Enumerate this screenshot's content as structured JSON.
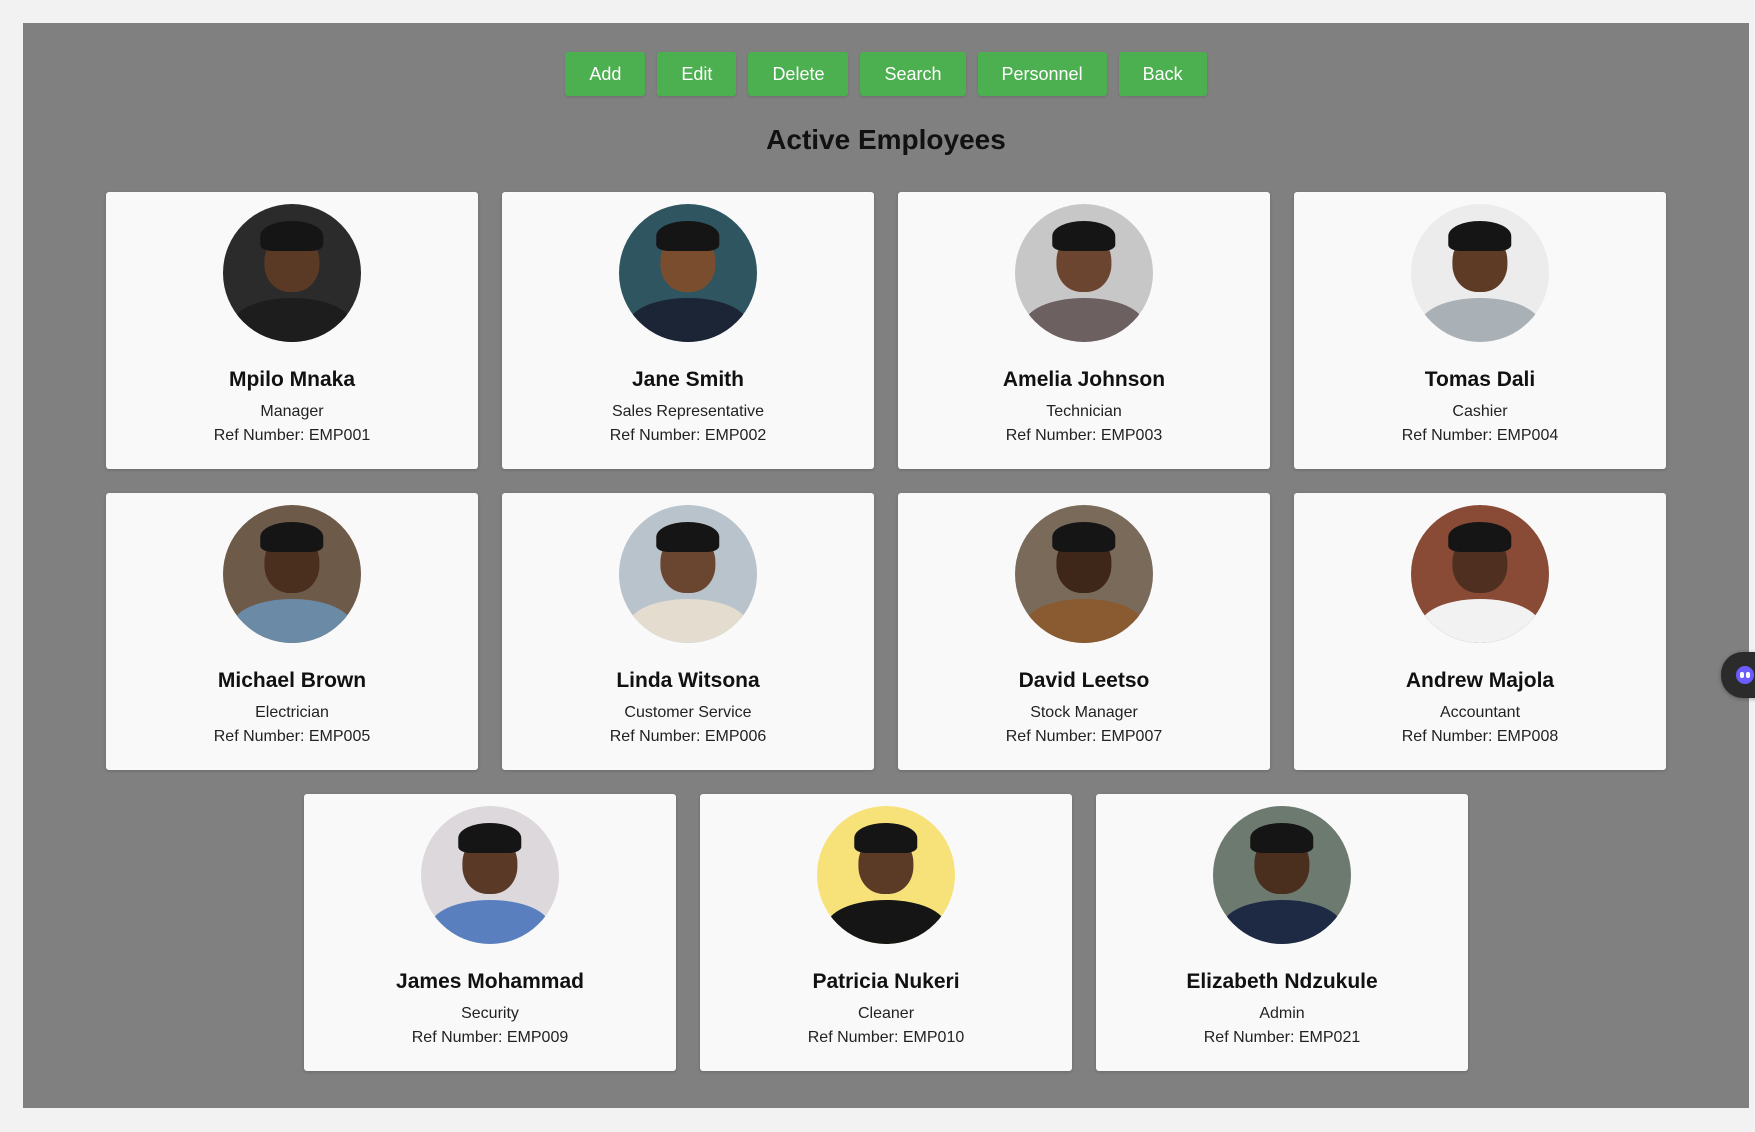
{
  "toolbar": {
    "buttons": [
      {
        "label": "Add"
      },
      {
        "label": "Edit"
      },
      {
        "label": "Delete"
      },
      {
        "label": "Search"
      },
      {
        "label": "Personnel"
      },
      {
        "label": "Back"
      }
    ]
  },
  "page": {
    "title": "Active Employees"
  },
  "employees": [
    {
      "name": "Mpilo Mnaka",
      "role": "Manager",
      "ref": "Ref Number: EMP001",
      "photo_bg": "#2b2b2b",
      "skin": "#5a3a24",
      "top": "#1d1d1d"
    },
    {
      "name": "Jane Smith",
      "role": "Sales Representative",
      "ref": "Ref Number: EMP002",
      "photo_bg": "#2e5560",
      "skin": "#7a4d2f",
      "top": "#1b2536"
    },
    {
      "name": "Amelia Johnson",
      "role": "Technician",
      "ref": "Ref Number: EMP003",
      "photo_bg": "#c7c7c7",
      "skin": "#6b4530",
      "top": "#6d6060"
    },
    {
      "name": "Tomas Dali",
      "role": "Cashier",
      "ref": "Ref Number: EMP004",
      "photo_bg": "#ececec",
      "skin": "#5e3b25",
      "top": "#a9b1b7"
    },
    {
      "name": "Michael Brown",
      "role": "Electrician",
      "ref": "Ref Number: EMP005",
      "photo_bg": "#6e5a48",
      "skin": "#4a2e1e",
      "top": "#6a8aa6"
    },
    {
      "name": "Linda Witsona",
      "role": "Customer Service",
      "ref": "Ref Number: EMP006",
      "photo_bg": "#b9c3cc",
      "skin": "#6a4630",
      "top": "#e3dccf"
    },
    {
      "name": "David Leetso",
      "role": "Stock Manager",
      "ref": "Ref Number: EMP007",
      "photo_bg": "#7a6a5a",
      "skin": "#3e2619",
      "top": "#8a5a30"
    },
    {
      "name": "Andrew Majola",
      "role": "Accountant",
      "ref": "Ref Number: EMP008",
      "photo_bg": "#8a4b36",
      "skin": "#4f3020",
      "top": "#f2f2f2"
    },
    {
      "name": "James Mohammad",
      "role": "Security",
      "ref": "Ref Number: EMP009",
      "photo_bg": "#dcd8dc",
      "skin": "#5a3a27",
      "top": "#5a7fbf"
    },
    {
      "name": "Patricia Nukeri",
      "role": "Cleaner",
      "ref": "Ref Number: EMP010",
      "photo_bg": "#f7e27a",
      "skin": "#5b3a26",
      "top": "#151515"
    },
    {
      "name": "Elizabeth Ndzukule",
      "role": "Admin",
      "ref": "Ref Number: EMP021",
      "photo_bg": "#6d7a70",
      "skin": "#4a2e1e",
      "top": "#1e2a44"
    }
  ]
}
